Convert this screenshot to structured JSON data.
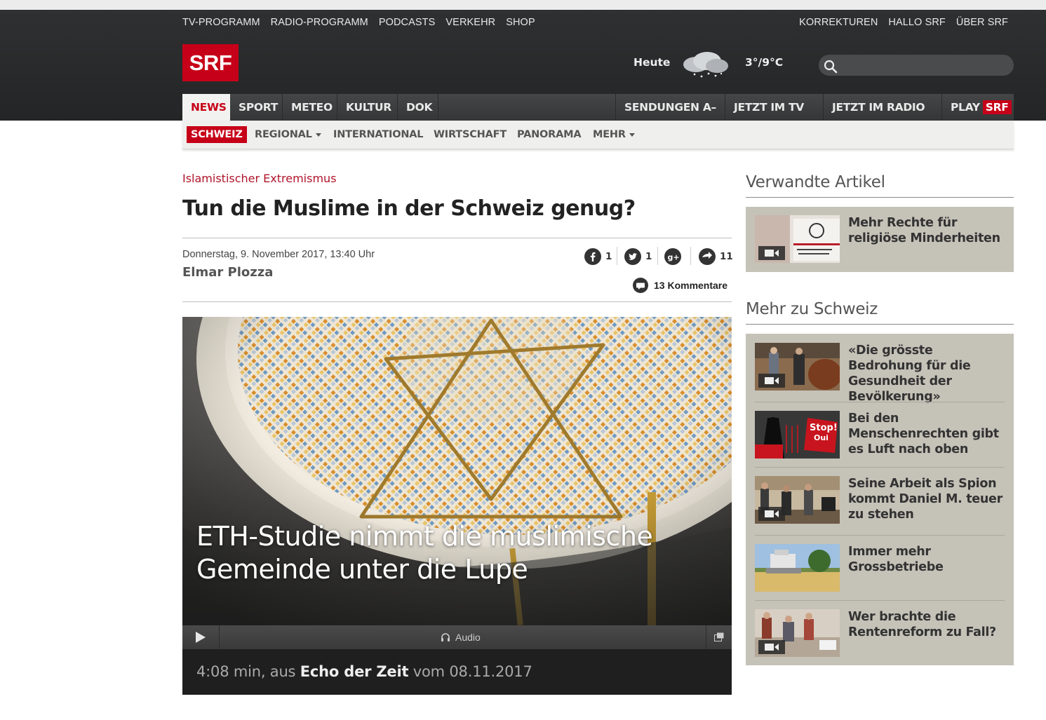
{
  "utility_nav": {
    "left": [
      "TV-PROGRAMM",
      "RADIO-PROGRAMM",
      "PODCASTS",
      "VERKEHR",
      "SHOP"
    ],
    "right": [
      "KORREKTUREN",
      "HALLO SRF",
      "ÜBER SRF"
    ]
  },
  "brand": {
    "logo": "SRF",
    "accent": "#c60018"
  },
  "weather": {
    "label": "Heute",
    "icon": "cloud-snow-icon",
    "temperature": "3°/9°C"
  },
  "search": {
    "placeholder": ""
  },
  "main_nav": {
    "items": [
      "NEWS",
      "SPORT",
      "METEO",
      "KULTUR",
      "DOK"
    ],
    "right_items": [
      "SENDUNGEN A–Z",
      "JETZT IM TV ﹀",
      "JETZT IM RADIO ﹀"
    ],
    "play_label": "PLAY",
    "play_badge": "SRF"
  },
  "sub_nav": {
    "items": [
      "SCHWEIZ",
      "REGIONAL",
      "INTERNATIONAL",
      "WIRTSCHAFT",
      "PANORAMA",
      "MEHR"
    ]
  },
  "article": {
    "kicker": "Islamistischer Extremismus",
    "title": "Tun die Muslime in der Schweiz genug?",
    "date": "Donnerstag, 9. November 2017, 13:40 Uhr",
    "author": "Elmar Plozza",
    "shares": {
      "facebook": "1",
      "twitter": "1",
      "google": "",
      "total": "11"
    },
    "comments": "13 Kommentare",
    "hero": {
      "headline": "ETH-Studie nimmt die muslimische Gemeinde unter die Lupe",
      "player_label": "Audio",
      "caption_prefix": "4:08 min, aus ",
      "caption_show": "Echo der Zeit",
      "caption_suffix": " vom 08.11.2017"
    }
  },
  "sidebar": {
    "related_heading": "Verwandte Artikel",
    "related": [
      {
        "title": "Mehr Rechte für religiöse Minderheiten",
        "video": true
      }
    ],
    "more_heading": "Mehr zu Schweiz",
    "more": [
      {
        "title": "«Die grösste Bedrohung für die Gesundheit der Bevölkerung»",
        "video": true
      },
      {
        "title": "Bei den Menschenrechten gibt es Luft nach oben",
        "video": false
      },
      {
        "title": "Seine Arbeit als Spion kommt Daniel M. teuer zu stehen",
        "video": true
      },
      {
        "title": "Immer mehr Grossbetriebe",
        "video": false
      },
      {
        "title": "Wer brachte die Rentenreform zu Fall?",
        "video": true
      }
    ]
  }
}
